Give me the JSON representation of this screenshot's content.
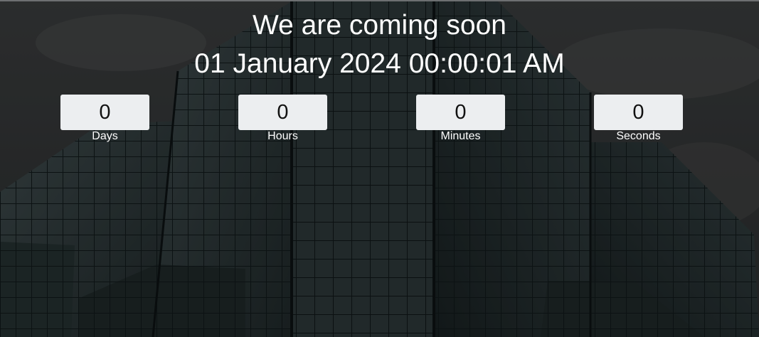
{
  "page": {
    "headline": "We are coming soon",
    "target_date": "01 January 2024 00:00:01 AM"
  },
  "countdown": [
    {
      "value": "0",
      "label": "Days"
    },
    {
      "value": "0",
      "label": "Hours"
    },
    {
      "value": "0",
      "label": "Minutes"
    },
    {
      "value": "0",
      "label": "Seconds"
    }
  ],
  "colors": {
    "overlay": "#2f3336",
    "box_background": "#eceef0",
    "text": "#ffffff",
    "box_text": "#111111"
  }
}
